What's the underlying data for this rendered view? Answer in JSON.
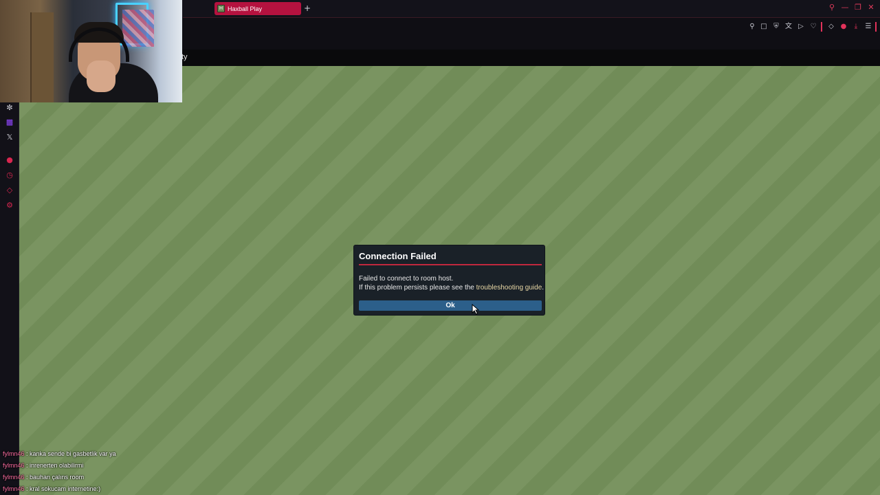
{
  "browser": {
    "tab_title": "Haxball Play",
    "tab_favicon": "H",
    "new_tab_label": "+",
    "page_text_fragment": "ty",
    "accent_color": "#e2325a"
  },
  "dialog": {
    "title": "Connection Failed",
    "message_line1": "Failed to connect to room host.",
    "message_line2_prefix": "If this problem persists please see the ",
    "link_text": "troubleshooting guide",
    "message_line2_suffix": ".",
    "ok_label": "Ok"
  },
  "chat": [
    {
      "user": "fylmn46",
      "text": " : kanka sende bi gasbetlik var ya"
    },
    {
      "user": "fylmn46",
      "text": " : inrenerten olabilirmi"
    },
    {
      "user": "fylmn46",
      "text": " : bauhan çalıns room"
    },
    {
      "user": "fylmn46",
      "text": " : kral sokucam internetine:)"
    }
  ],
  "icons": {
    "sidebar": [
      "chatgpt-icon",
      "twitch-icon",
      "x-icon",
      "record-icon",
      "history-icon",
      "extensions-icon",
      "settings-icon"
    ],
    "toolbar": [
      "pin-icon",
      "screenshot-icon",
      "shield-icon",
      "translate-icon",
      "play-icon",
      "heart-icon",
      "extensions-icon",
      "account-icon",
      "download-icon",
      "menu-icon"
    ]
  }
}
